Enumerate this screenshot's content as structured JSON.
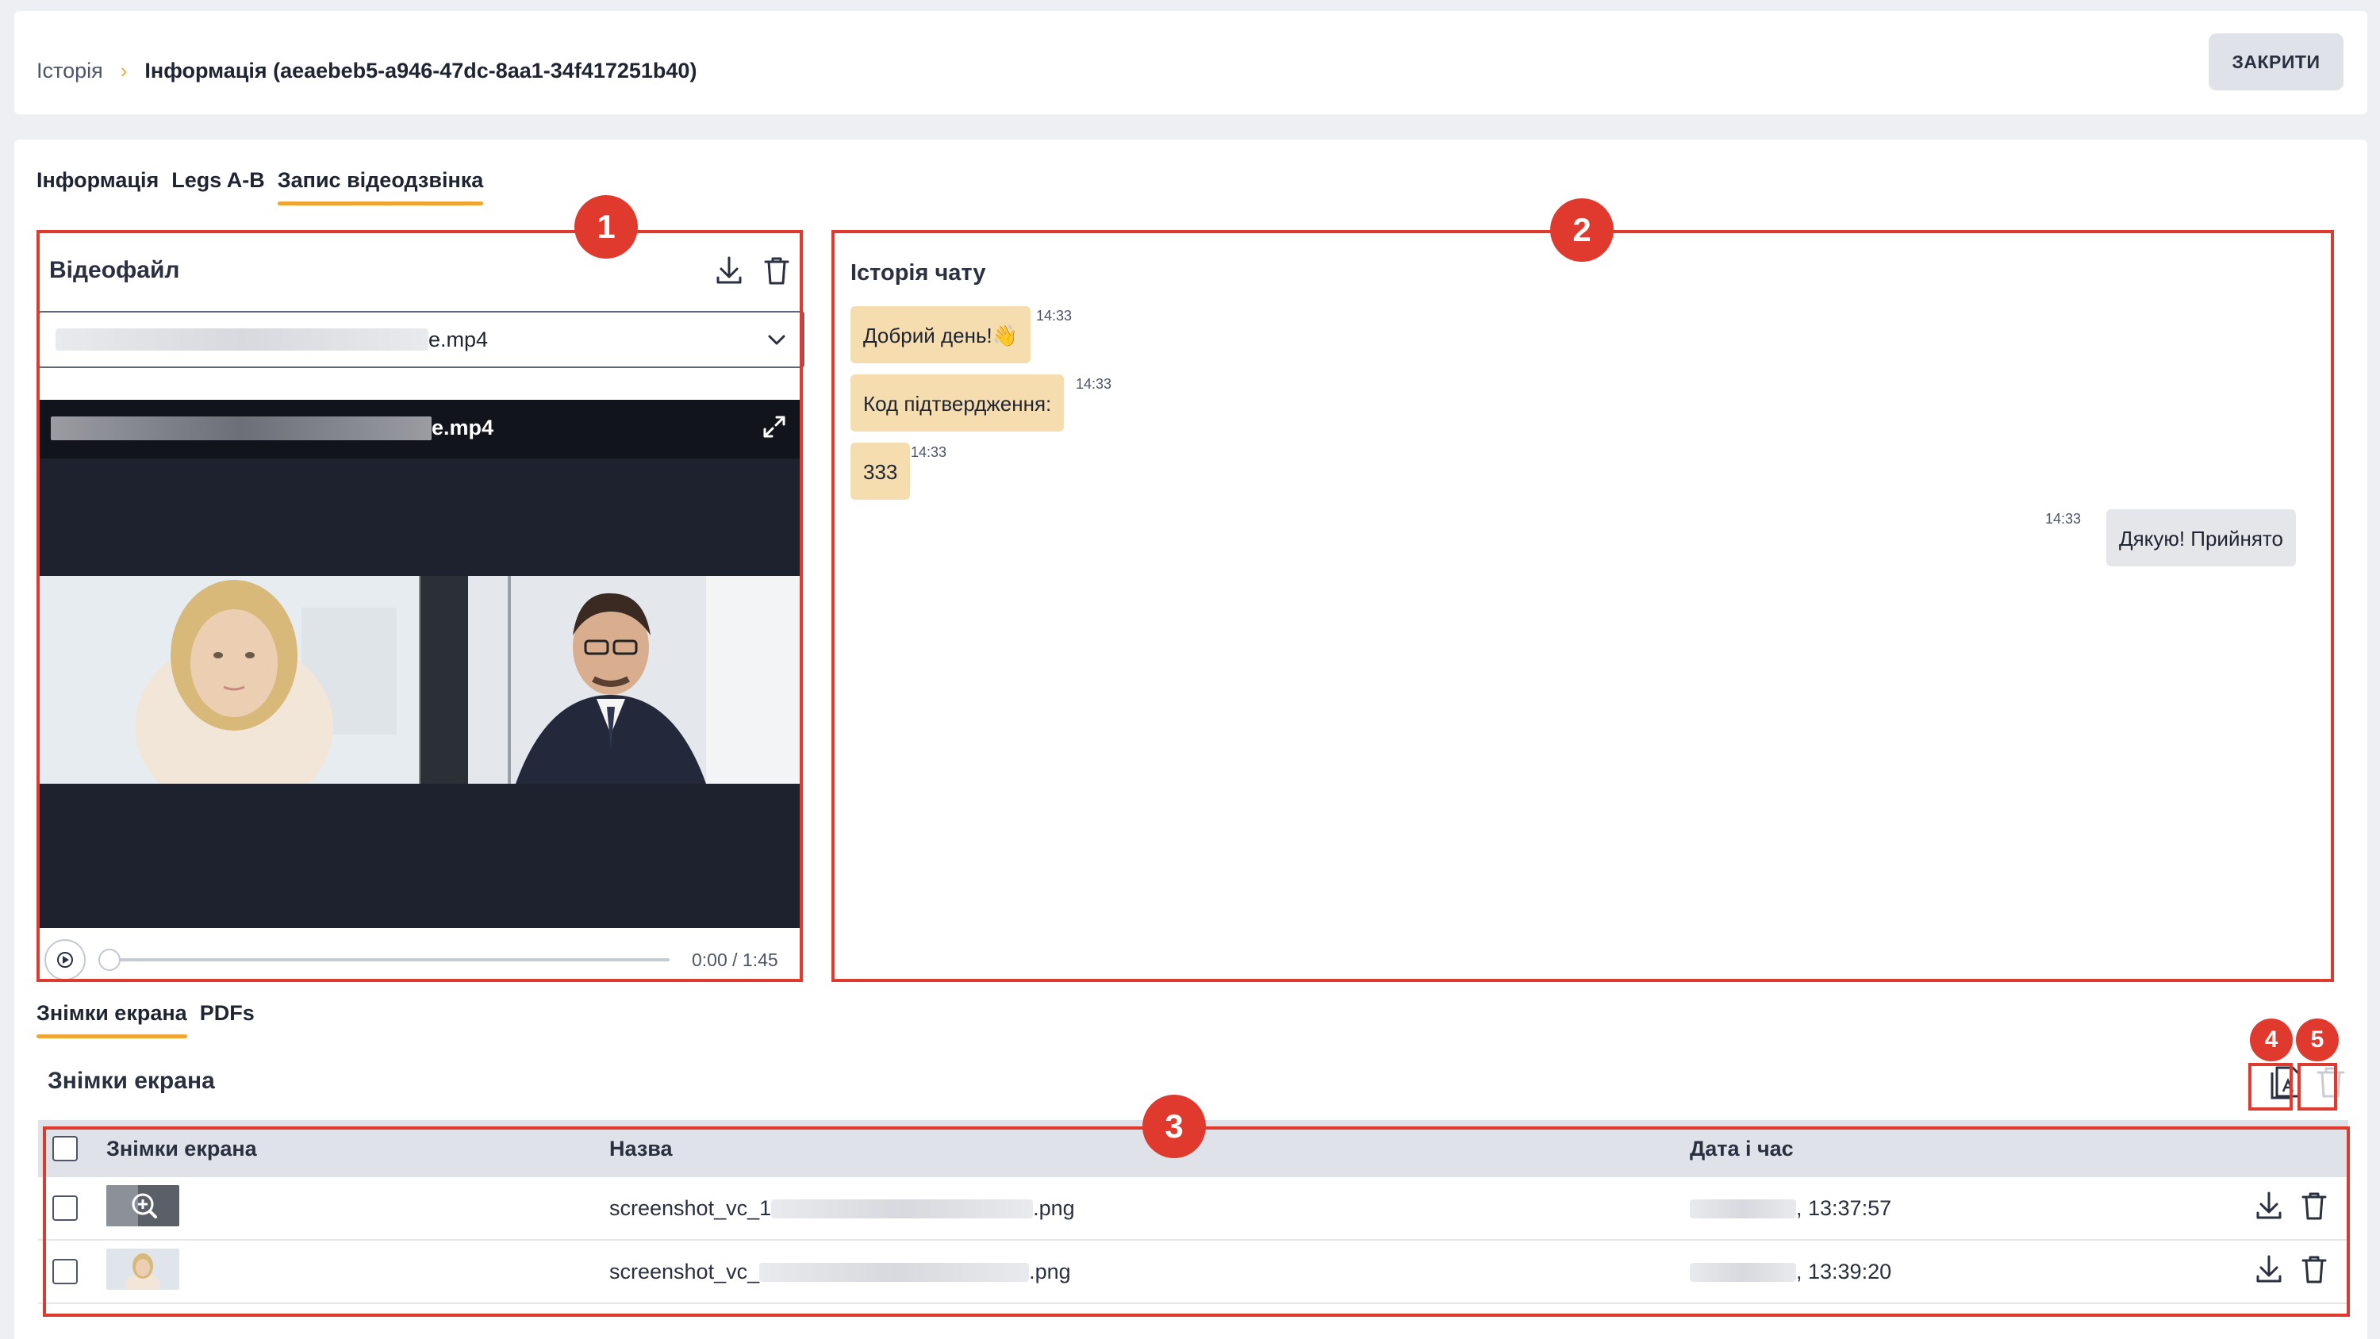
{
  "breadcrumb": {
    "root": "Історія",
    "separator": "›",
    "current": "Інформація (aeaebeb5-a946-47dc-8aa1-34f417251b40)"
  },
  "close_label": "ЗАКРИТИ",
  "tabs": [
    {
      "label": "Інформація",
      "active": false
    },
    {
      "label": "Legs A-B",
      "active": false
    },
    {
      "label": "Запис відеодзвінка",
      "active": true
    }
  ],
  "video": {
    "title": "Відеофайл",
    "selected_file_suffix": "e.mp4",
    "player_file_suffix": "e.mp4",
    "time": "0:00 / 1:45",
    "progress": 0
  },
  "chat": {
    "title": "Історія чату",
    "messages": [
      {
        "text": "Добрий день!👋",
        "time": "14:33",
        "side": "in"
      },
      {
        "text": "Код підтвердження:",
        "time": "14:33",
        "side": "in"
      },
      {
        "text": "333",
        "time": "14:33",
        "side": "in"
      },
      {
        "text": "Дякую! Прийнято",
        "time": "14:33",
        "side": "out"
      }
    ]
  },
  "bottom_tabs": [
    {
      "label": "Знімки екрана",
      "active": true
    },
    {
      "label": "PDFs",
      "active": false
    }
  ],
  "screenshots": {
    "title": "Знімки екрана",
    "columns": [
      "Знімки екрана",
      "Назва",
      "Дата і час"
    ],
    "rows": [
      {
        "name_prefix": "screenshot_vc_1",
        "name_suffix": ".png",
        "time": ", 13:37:57"
      },
      {
        "name_prefix": "screenshot_vc_",
        "name_suffix": ".png",
        "time": ", 13:39:20"
      }
    ]
  },
  "annotations": [
    "1",
    "2",
    "3",
    "4",
    "5"
  ],
  "colors": {
    "accent": "#f0a532",
    "annotation": "#e03a2e",
    "incoming_bubble": "#f5ddb0",
    "outgoing_bubble": "#e5e6ea"
  }
}
